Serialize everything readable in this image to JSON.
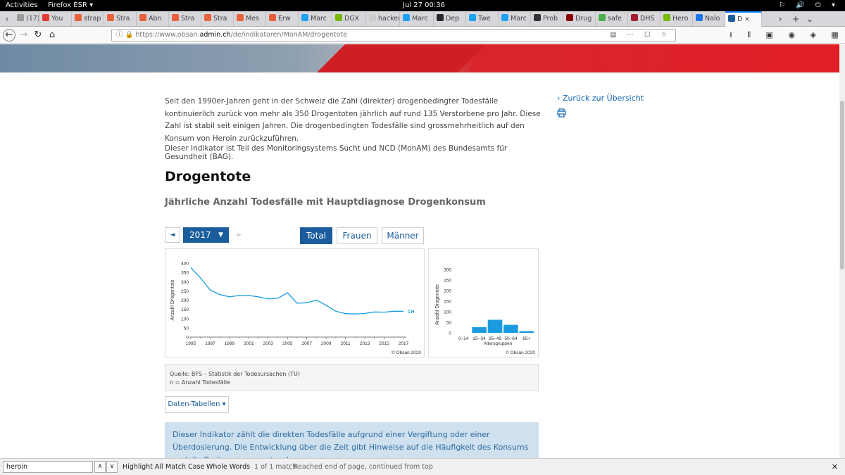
{
  "system": {
    "activities": "Activities",
    "app_name": "Firefox ESR ▾",
    "clock": "Jul 27  00:36",
    "tray": "⚐ 🔊 ⏻ ▾"
  },
  "tabs": [
    {
      "label": "(17)",
      "color": "#999999"
    },
    {
      "label": "You",
      "color": "#e53935"
    },
    {
      "label": "strap",
      "color": "#e8613c"
    },
    {
      "label": "Stra",
      "color": "#e8613c"
    },
    {
      "label": "Abn",
      "color": "#e8613c"
    },
    {
      "label": "Stra",
      "color": "#e8613c"
    },
    {
      "label": "Stra",
      "color": "#e8613c"
    },
    {
      "label": "Mes",
      "color": "#e8613c"
    },
    {
      "label": "Erw",
      "color": "#e8613c"
    },
    {
      "label": "Marc",
      "color": "#1da1f2"
    },
    {
      "label": "DGX",
      "color": "#76b900"
    },
    {
      "label": "hackers",
      "color": "#cccccc"
    },
    {
      "label": "Marc",
      "color": "#1da1f2"
    },
    {
      "label": "Dep",
      "color": "#24292e"
    },
    {
      "label": "Twe",
      "color": "#1da1f2"
    },
    {
      "label": "Marc",
      "color": "#1da1f2"
    },
    {
      "label": "Prob",
      "color": "#333333"
    },
    {
      "label": "Drug",
      "color": "#8b0000"
    },
    {
      "label": "safe",
      "color": "#4caf50"
    },
    {
      "label": "DHS",
      "color": "#a31e2f"
    },
    {
      "label": "Hero",
      "color": "#76b900"
    },
    {
      "label": "Nalo",
      "color": "#1a73e8"
    },
    {
      "label": "D",
      "color": "#1a5c9c",
      "active": true
    }
  ],
  "nav": {
    "url_prefix": "https://www.obsan.",
    "url_domain": "admin.ch",
    "url_path": "/de/indikatoren/MonAM/drogentote",
    "page_actions": "▤  ⋯ ☐ ☆",
    "toolbar_icons": "⭳ ⫴ ▣ ◉ ◈ ▦ ≡"
  },
  "page": {
    "intro": "Seit den 1990er-Jahren geht in der Schweiz die Zahl (direkter) drogenbedingter Todesfälle kontinuierlich zurück von mehr als 350 Drogentoten jährlich auf rund 135 Verstorbene pro Jahr. Diese Zahl ist stabil seit einigen Jahren. Die drogenbedingten Todesfälle sind grossmehrheitlich auf den Konsum von Heroin zurückzuführen.",
    "intro2": "Dieser Indikator ist Teil des Monitoringsystems Sucht und NCD (MonAM) des Bundesamts für Gesundheit (BAG).",
    "title": "Drogentote",
    "subtitle": "Jährliche Anzahl Todesfälle mit Hauptdiagnose Drogenkonsum",
    "back_link": "Zurück zur Übersicht",
    "year": "2017",
    "prev_symbol": "◄",
    "next_symbol": "►",
    "dropdown_symbol": "▼",
    "segments": [
      {
        "label": "Total",
        "active": true
      },
      {
        "label": "Frauen",
        "active": false
      },
      {
        "label": "Männer",
        "active": false
      }
    ],
    "source_line1": "Quelle: BFS – Statistik der Todesursachen (TU)",
    "source_line2": "n = Anzahl Todesfälle",
    "data_tables_button": "Daten-Tabellen ▾",
    "info_text": "Dieser Indikator zählt die direkten Todesfälle aufgrund einer Vergiftung oder einer Überdosierung. Die Entwicklung über die Zeit gibt Hinweise auf die Häufigkeit des Konsums und die Bedingungen, unter denen"
  },
  "chart_data": [
    {
      "type": "line",
      "ylabel": "Anzahl Drogentote",
      "ylim": [
        0,
        400
      ],
      "yticks": [
        0,
        50,
        100,
        150,
        200,
        250,
        300,
        350,
        400
      ],
      "xticks": [
        "1995",
        "1997",
        "1999",
        "2001",
        "2003",
        "2005",
        "2007",
        "2009",
        "2011",
        "2013",
        "2015",
        "2017"
      ],
      "series": [
        {
          "name": "CH",
          "color": "#1a9be0",
          "x": [
            1995,
            1996,
            1997,
            1998,
            1999,
            2000,
            2001,
            2002,
            2003,
            2004,
            2005,
            2006,
            2007,
            2008,
            2009,
            2010,
            2011,
            2012,
            2013,
            2014,
            2015,
            2016,
            2017
          ],
          "values": [
            376,
            320,
            255,
            230,
            218,
            225,
            225,
            218,
            207,
            210,
            240,
            183,
            186,
            200,
            172,
            140,
            127,
            125,
            128,
            136,
            135,
            140,
            140
          ]
        }
      ],
      "credit": "© Obsan 2020"
    },
    {
      "type": "bar",
      "ylabel": "Anzahl Drogentote",
      "xlabel": "Altersgruppen",
      "ylim": [
        0,
        300
      ],
      "yticks": [
        0,
        50,
        100,
        150,
        200,
        250,
        300
      ],
      "categories": [
        "0–14",
        "15–34",
        "35–49",
        "50–64",
        "65+"
      ],
      "values": [
        0,
        27,
        62,
        38,
        8
      ],
      "color": "#1a9be0",
      "credit": "© Obsan 2020"
    }
  ],
  "findbar": {
    "query": "heroin",
    "highlight_all": "Highlight All",
    "match_case": "Match Case",
    "whole_words": "Whole Words",
    "count": "1 of 1 match",
    "status": "Reached end of page, continued from top"
  }
}
